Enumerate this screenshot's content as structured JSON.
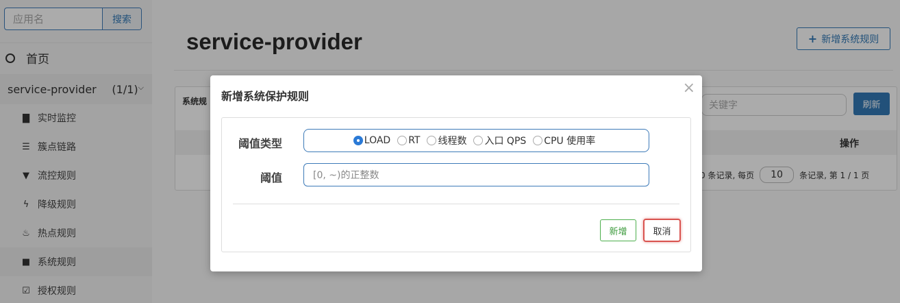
{
  "sidebar": {
    "search_placeholder": "应用名",
    "search_button": "搜索",
    "home_label": "首页",
    "app_name": "service-provider",
    "app_count": "(1/1)",
    "items": [
      {
        "label": "实时监控",
        "icon": "bar-chart-icon"
      },
      {
        "label": "簇点链路",
        "icon": "list-icon"
      },
      {
        "label": "流控规则",
        "icon": "filter-icon"
      },
      {
        "label": "降级规则",
        "icon": "flash-icon"
      },
      {
        "label": "热点规则",
        "icon": "fire-icon"
      },
      {
        "label": "系统规则",
        "icon": "lock-icon"
      },
      {
        "label": "授权规则",
        "icon": "check-icon"
      }
    ]
  },
  "main": {
    "title": "service-provider",
    "new_rule_button": "新增系统规则",
    "panel_label": "系统规",
    "keyword_placeholder": "关键字",
    "refresh_button": "刷新",
    "operation_header": "操作",
    "pager": {
      "prefix": "0 条记录, 每页",
      "page_size": "10",
      "suffix": "条记录, 第 1 / 1 页"
    }
  },
  "modal": {
    "title": "新增系统保护规则",
    "close": "×",
    "threshold_type_label": "阈值类型",
    "radio_options": [
      {
        "label": "LOAD",
        "selected": true
      },
      {
        "label": "RT",
        "selected": false
      },
      {
        "label": "线程数",
        "selected": false
      },
      {
        "label": "入口 QPS",
        "selected": false
      },
      {
        "label": "CPU 使用率",
        "selected": false
      }
    ],
    "threshold_label": "阈值",
    "threshold_placeholder": "[0, ~)的正整数",
    "add_button": "新增",
    "cancel_button": "取消"
  },
  "colors": {
    "primary": "#337ab7",
    "success": "#4cae4c",
    "danger": "#d9534f"
  }
}
